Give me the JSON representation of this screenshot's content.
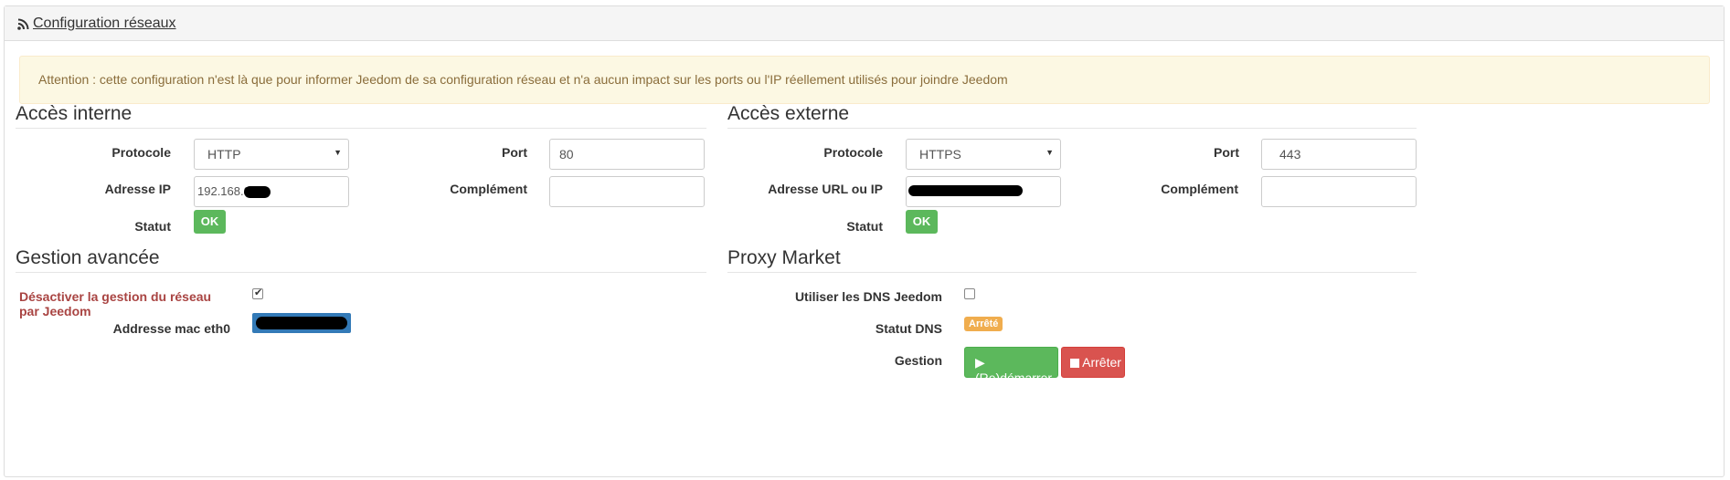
{
  "panel": {
    "title": "Configuration réseaux",
    "icon": "rss-icon"
  },
  "alert": {
    "text": "Attention : cette configuration n'est là que pour informer Jeedom de sa configuration réseau et n'a aucun impact sur les ports ou l'IP réellement utilisés pour joindre Jeedom"
  },
  "internal": {
    "legend": "Accès interne",
    "protocol_label": "Protocole",
    "protocol_value": "HTTP",
    "port_label": "Port",
    "port_value": "80",
    "ip_label": "Adresse IP",
    "ip_value": "192.168.0.",
    "complement_label": "Complément",
    "complement_value": "",
    "status_label": "Statut",
    "status_value": "OK"
  },
  "external": {
    "legend": "Accès externe",
    "protocol_label": "Protocole",
    "protocol_value": "HTTPS",
    "port_label": "Port",
    "port_value": "443",
    "url_label": "Adresse URL ou IP",
    "complement_label": "Complément",
    "complement_value": "",
    "status_label": "Statut",
    "status_value": "OK"
  },
  "advanced": {
    "legend": "Gestion avancée",
    "disable_label": "Désactiver la gestion du réseau par Jeedom",
    "disable_checked": true,
    "mac_label": "Addresse mac eth0"
  },
  "proxy": {
    "legend": "Proxy Market",
    "dns_label": "Utiliser les DNS Jeedom",
    "dns_checked": false,
    "dns_status_label": "Statut DNS",
    "dns_status_value": "Arrêté",
    "manage_label": "Gestion",
    "restart_button": "(Re)démarrer",
    "stop_button": "Arrêter"
  },
  "colors": {
    "success": "#5cb85c",
    "danger": "#d9534f",
    "warning": "#f0ad4e",
    "alert_bg": "#fcf8e3",
    "alert_text": "#8a6d3b",
    "selection": "#337ab7"
  }
}
